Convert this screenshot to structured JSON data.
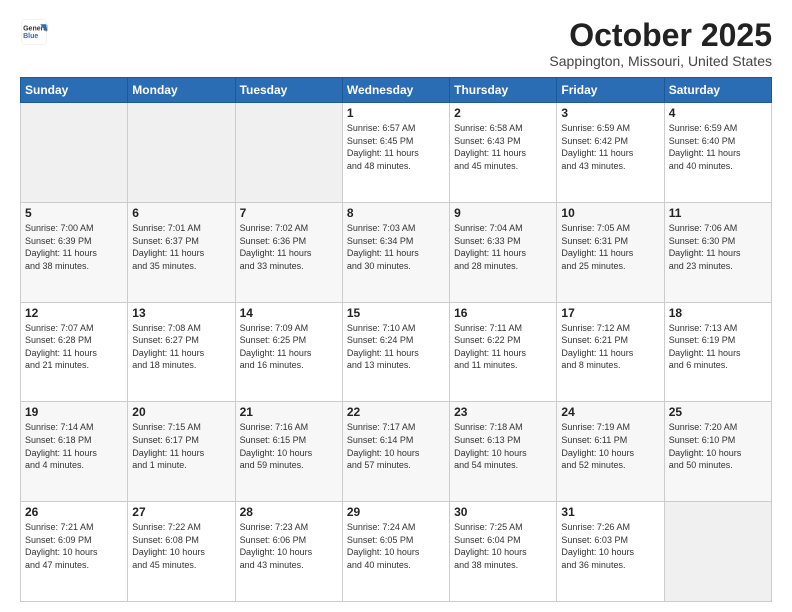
{
  "logo": {
    "general": "General",
    "blue": "Blue"
  },
  "header": {
    "month": "October 2025",
    "location": "Sappington, Missouri, United States"
  },
  "days_of_week": [
    "Sunday",
    "Monday",
    "Tuesday",
    "Wednesday",
    "Thursday",
    "Friday",
    "Saturday"
  ],
  "weeks": [
    [
      {
        "day": "",
        "info": ""
      },
      {
        "day": "",
        "info": ""
      },
      {
        "day": "",
        "info": ""
      },
      {
        "day": "1",
        "info": "Sunrise: 6:57 AM\nSunset: 6:45 PM\nDaylight: 11 hours\nand 48 minutes."
      },
      {
        "day": "2",
        "info": "Sunrise: 6:58 AM\nSunset: 6:43 PM\nDaylight: 11 hours\nand 45 minutes."
      },
      {
        "day": "3",
        "info": "Sunrise: 6:59 AM\nSunset: 6:42 PM\nDaylight: 11 hours\nand 43 minutes."
      },
      {
        "day": "4",
        "info": "Sunrise: 6:59 AM\nSunset: 6:40 PM\nDaylight: 11 hours\nand 40 minutes."
      }
    ],
    [
      {
        "day": "5",
        "info": "Sunrise: 7:00 AM\nSunset: 6:39 PM\nDaylight: 11 hours\nand 38 minutes."
      },
      {
        "day": "6",
        "info": "Sunrise: 7:01 AM\nSunset: 6:37 PM\nDaylight: 11 hours\nand 35 minutes."
      },
      {
        "day": "7",
        "info": "Sunrise: 7:02 AM\nSunset: 6:36 PM\nDaylight: 11 hours\nand 33 minutes."
      },
      {
        "day": "8",
        "info": "Sunrise: 7:03 AM\nSunset: 6:34 PM\nDaylight: 11 hours\nand 30 minutes."
      },
      {
        "day": "9",
        "info": "Sunrise: 7:04 AM\nSunset: 6:33 PM\nDaylight: 11 hours\nand 28 minutes."
      },
      {
        "day": "10",
        "info": "Sunrise: 7:05 AM\nSunset: 6:31 PM\nDaylight: 11 hours\nand 25 minutes."
      },
      {
        "day": "11",
        "info": "Sunrise: 7:06 AM\nSunset: 6:30 PM\nDaylight: 11 hours\nand 23 minutes."
      }
    ],
    [
      {
        "day": "12",
        "info": "Sunrise: 7:07 AM\nSunset: 6:28 PM\nDaylight: 11 hours\nand 21 minutes."
      },
      {
        "day": "13",
        "info": "Sunrise: 7:08 AM\nSunset: 6:27 PM\nDaylight: 11 hours\nand 18 minutes."
      },
      {
        "day": "14",
        "info": "Sunrise: 7:09 AM\nSunset: 6:25 PM\nDaylight: 11 hours\nand 16 minutes."
      },
      {
        "day": "15",
        "info": "Sunrise: 7:10 AM\nSunset: 6:24 PM\nDaylight: 11 hours\nand 13 minutes."
      },
      {
        "day": "16",
        "info": "Sunrise: 7:11 AM\nSunset: 6:22 PM\nDaylight: 11 hours\nand 11 minutes."
      },
      {
        "day": "17",
        "info": "Sunrise: 7:12 AM\nSunset: 6:21 PM\nDaylight: 11 hours\nand 8 minutes."
      },
      {
        "day": "18",
        "info": "Sunrise: 7:13 AM\nSunset: 6:19 PM\nDaylight: 11 hours\nand 6 minutes."
      }
    ],
    [
      {
        "day": "19",
        "info": "Sunrise: 7:14 AM\nSunset: 6:18 PM\nDaylight: 11 hours\nand 4 minutes."
      },
      {
        "day": "20",
        "info": "Sunrise: 7:15 AM\nSunset: 6:17 PM\nDaylight: 11 hours\nand 1 minute."
      },
      {
        "day": "21",
        "info": "Sunrise: 7:16 AM\nSunset: 6:15 PM\nDaylight: 10 hours\nand 59 minutes."
      },
      {
        "day": "22",
        "info": "Sunrise: 7:17 AM\nSunset: 6:14 PM\nDaylight: 10 hours\nand 57 minutes."
      },
      {
        "day": "23",
        "info": "Sunrise: 7:18 AM\nSunset: 6:13 PM\nDaylight: 10 hours\nand 54 minutes."
      },
      {
        "day": "24",
        "info": "Sunrise: 7:19 AM\nSunset: 6:11 PM\nDaylight: 10 hours\nand 52 minutes."
      },
      {
        "day": "25",
        "info": "Sunrise: 7:20 AM\nSunset: 6:10 PM\nDaylight: 10 hours\nand 50 minutes."
      }
    ],
    [
      {
        "day": "26",
        "info": "Sunrise: 7:21 AM\nSunset: 6:09 PM\nDaylight: 10 hours\nand 47 minutes."
      },
      {
        "day": "27",
        "info": "Sunrise: 7:22 AM\nSunset: 6:08 PM\nDaylight: 10 hours\nand 45 minutes."
      },
      {
        "day": "28",
        "info": "Sunrise: 7:23 AM\nSunset: 6:06 PM\nDaylight: 10 hours\nand 43 minutes."
      },
      {
        "day": "29",
        "info": "Sunrise: 7:24 AM\nSunset: 6:05 PM\nDaylight: 10 hours\nand 40 minutes."
      },
      {
        "day": "30",
        "info": "Sunrise: 7:25 AM\nSunset: 6:04 PM\nDaylight: 10 hours\nand 38 minutes."
      },
      {
        "day": "31",
        "info": "Sunrise: 7:26 AM\nSunset: 6:03 PM\nDaylight: 10 hours\nand 36 minutes."
      },
      {
        "day": "",
        "info": ""
      }
    ]
  ]
}
